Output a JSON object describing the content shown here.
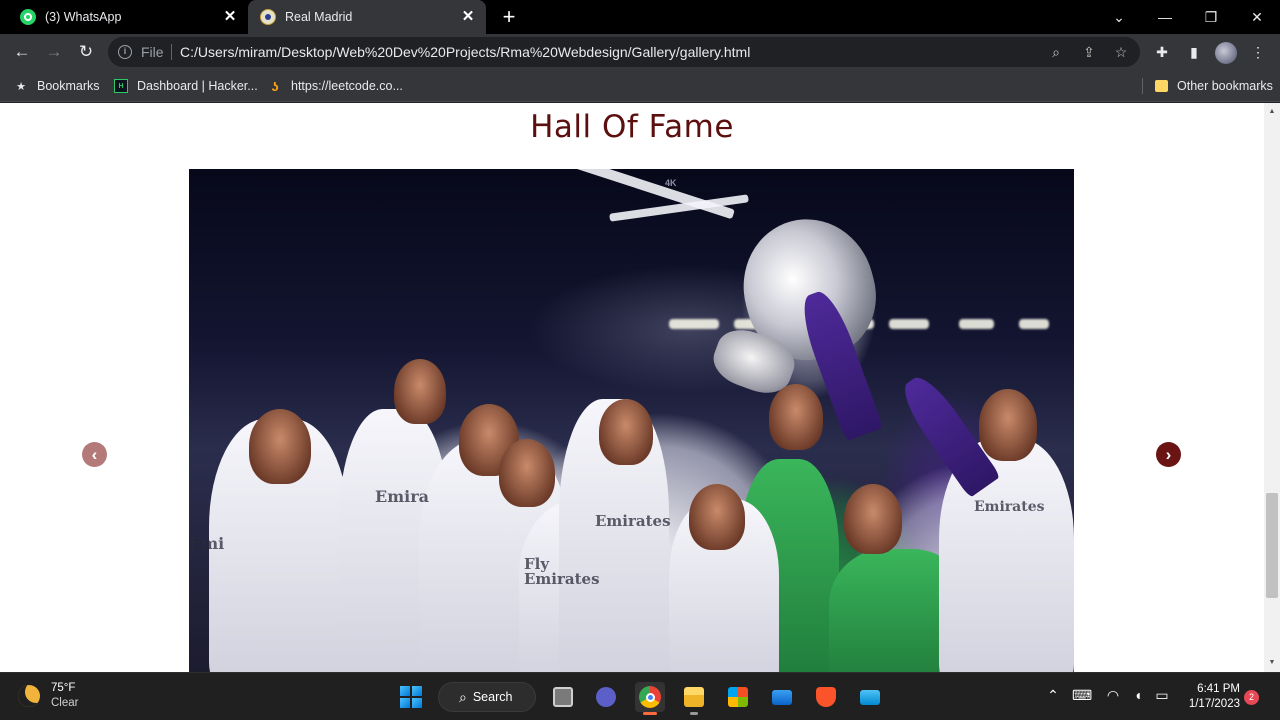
{
  "browser": {
    "tabs": [
      {
        "title": "(3) WhatsApp",
        "active": false
      },
      {
        "title": "Real Madrid",
        "active": true
      }
    ],
    "address": {
      "scheme_label": "File",
      "url": "C:/Users/miram/Desktop/Web%20Dev%20Projects/Rma%20Webdesign/Gallery/gallery.html"
    },
    "bookmarks": [
      {
        "label": "Bookmarks",
        "icon": "star-icon"
      },
      {
        "label": "Dashboard | Hacker...",
        "icon": "hackerrank-icon"
      },
      {
        "label": "https://leetcode.co...",
        "icon": "leetcode-icon"
      }
    ],
    "other_bookmarks": "Other bookmarks",
    "hackerrank_glyph": "H",
    "leetcode_glyph": "ʖ"
  },
  "page": {
    "heading": "Hall Of Fame",
    "slide_badge": "4K",
    "sponsor_texts": [
      "Emi",
      "Emira",
      "Emirates",
      "Fly Emirates",
      "Emirates"
    ],
    "prev_arrow": "‹",
    "next_arrow": "›",
    "colors": {
      "heading": "#5b0f0f",
      "prev_arrow": "#b47a7a",
      "next_arrow": "#6a1414"
    }
  },
  "taskbar": {
    "weather": {
      "temp": "75°F",
      "condition": "Clear"
    },
    "search_label": "Search",
    "clock": {
      "time": "6:41 PM",
      "date": "1/17/2023"
    },
    "notification_count": "2",
    "apps": [
      "windows-start",
      "task-view",
      "teams-chat",
      "chrome",
      "file-explorer",
      "microsoft-store",
      "mail",
      "brave",
      "remote-desktop"
    ]
  }
}
